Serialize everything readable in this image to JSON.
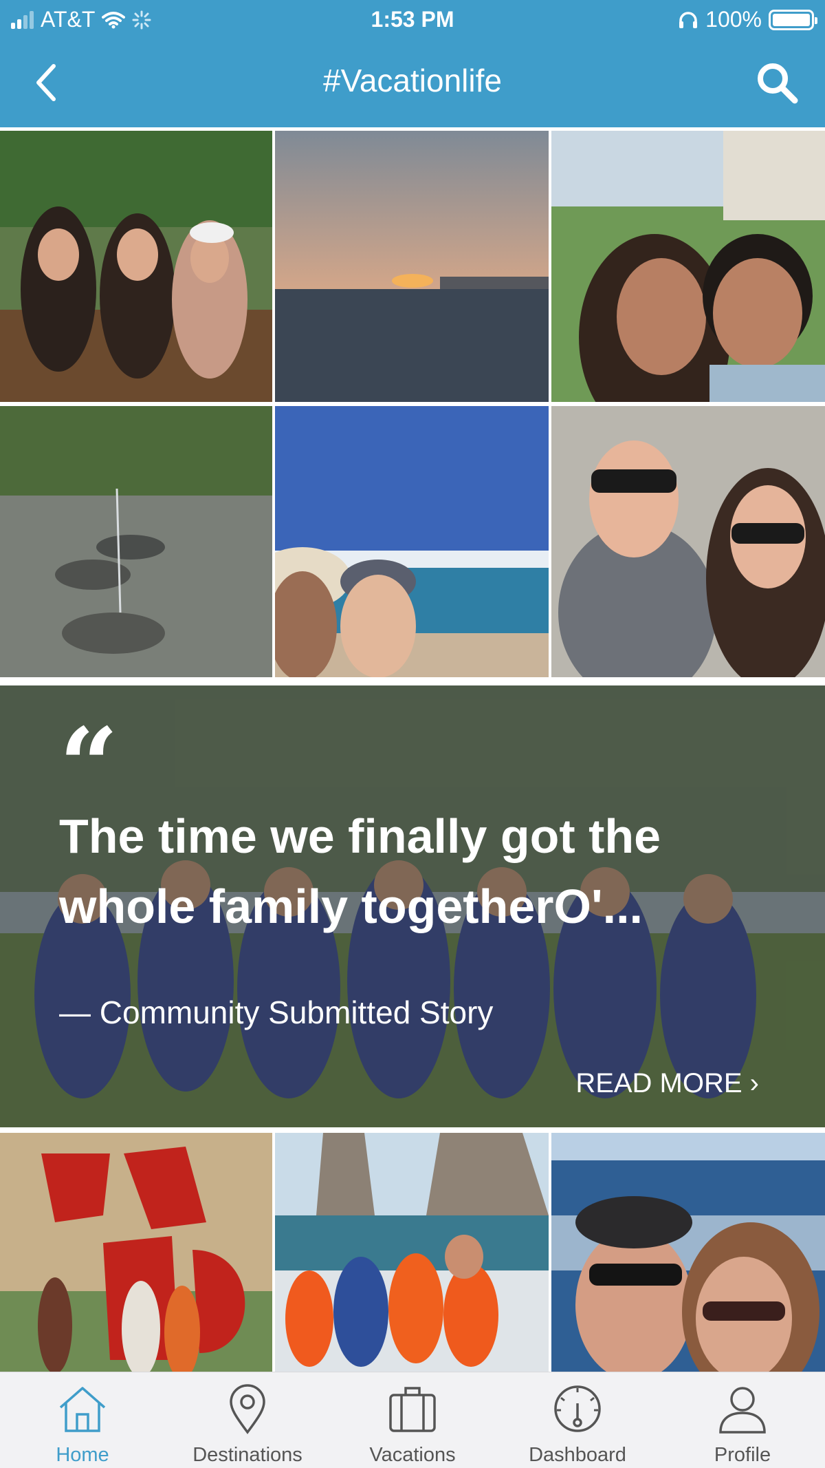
{
  "status_bar": {
    "carrier": "AT&T",
    "time": "1:53 PM",
    "battery": "100%"
  },
  "nav": {
    "title": "#Vacationlife"
  },
  "photo_grid_top": [
    {
      "name": "photo-three-friends-restaurant"
    },
    {
      "name": "photo-ocean-sunset"
    },
    {
      "name": "photo-couple-selfie-resort"
    },
    {
      "name": "photo-turtle-fountain"
    },
    {
      "name": "photo-beach-selfie-hats"
    },
    {
      "name": "photo-helicopter-couple"
    }
  ],
  "story": {
    "quote_mark": "“",
    "title": "The time we finally got the whole family togetherO'...",
    "credit": "— Community Submitted Story",
    "read_more": "READ MORE ›"
  },
  "photo_grid_bottom": [
    {
      "name": "photo-cabo-sign"
    },
    {
      "name": "photo-boat-life-jackets"
    },
    {
      "name": "photo-couple-ocean-selfie"
    }
  ],
  "tabs": [
    {
      "label": "Home",
      "icon": "home-icon",
      "active": true
    },
    {
      "label": "Destinations",
      "icon": "map-pin-icon",
      "active": false
    },
    {
      "label": "Vacations",
      "icon": "suitcase-icon",
      "active": false
    },
    {
      "label": "Dashboard",
      "icon": "dashboard-icon",
      "active": false
    },
    {
      "label": "Profile",
      "icon": "profile-icon",
      "active": false
    }
  ],
  "colors": {
    "header": "#3f9dca",
    "tab_active": "#3f9dca",
    "tab_inactive": "#555555"
  }
}
